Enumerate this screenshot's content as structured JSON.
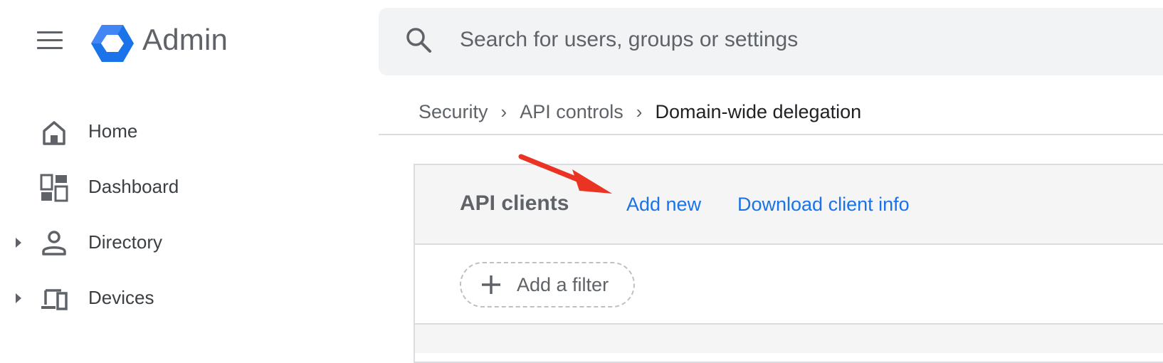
{
  "app": {
    "name": "Admin"
  },
  "search": {
    "placeholder": "Search for users, groups or settings"
  },
  "sidebar": {
    "items": [
      {
        "label": "Home",
        "icon": "home-icon"
      },
      {
        "label": "Dashboard",
        "icon": "dashboard-icon"
      },
      {
        "label": "Directory",
        "icon": "person-icon",
        "expandable": true
      },
      {
        "label": "Devices",
        "icon": "devices-icon",
        "expandable": true
      }
    ]
  },
  "breadcrumb": {
    "items": [
      "Security",
      "API controls"
    ],
    "current": "Domain-wide delegation"
  },
  "card": {
    "title": "API clients",
    "add_new": "Add new",
    "download": "Download client info",
    "filter_label": "Add a filter"
  },
  "colors": {
    "link": "#1a73e8",
    "annotation_arrow": "#ea3323",
    "logo_primary": "#1a73e8",
    "logo_secondary": "#4285f4"
  }
}
